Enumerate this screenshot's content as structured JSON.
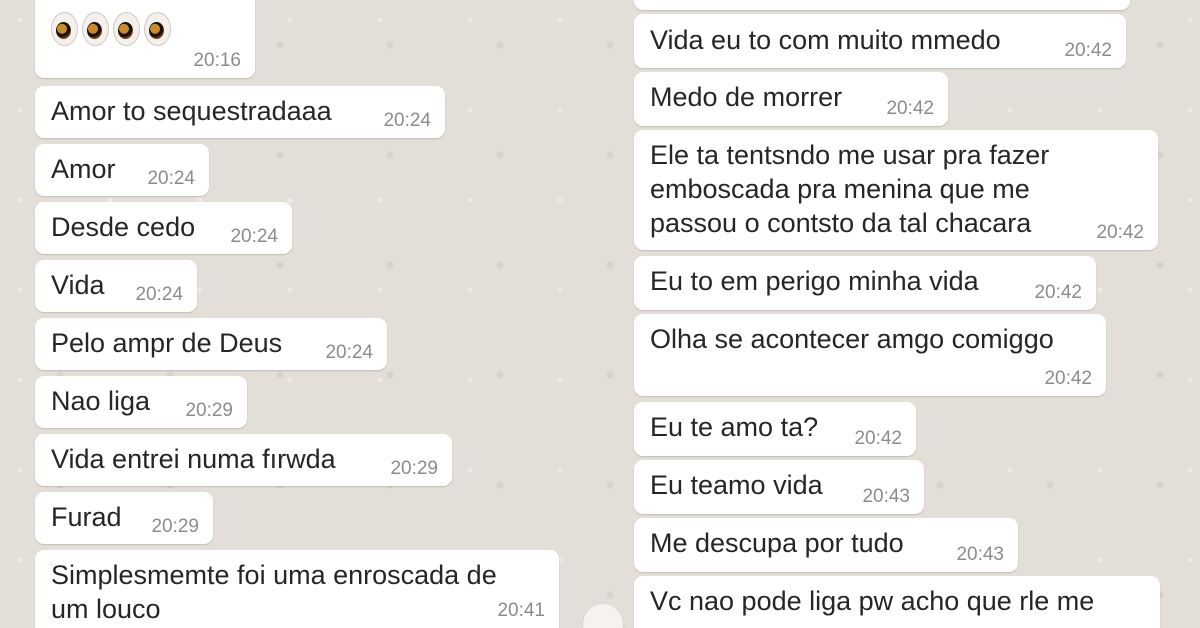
{
  "left_messages": [
    {
      "text": "",
      "time": "20:16",
      "emoji": "👀👀"
    },
    {
      "text": "Amor to sequestradaaa",
      "time": "20:24"
    },
    {
      "text": "Amor",
      "time": "20:24"
    },
    {
      "text": "Desde cedo",
      "time": "20:24"
    },
    {
      "text": "Vida",
      "time": "20:24"
    },
    {
      "text": "Pelo ampr de Deus",
      "time": "20:24"
    },
    {
      "text": "Nao liga",
      "time": "20:29"
    },
    {
      "text": "Vida entrei numa fırwda",
      "time": "20:29"
    },
    {
      "text": "Furad",
      "time": "20:29"
    },
    {
      "text": "Simplesmemte foi uma enroscada de\num louco",
      "time": "20:41"
    }
  ],
  "right_messages": [
    {
      "text": "",
      "time": ""
    },
    {
      "text": "Vida eu to com muito mmedo",
      "time": "20:42"
    },
    {
      "text": "Medo de morrer",
      "time": "20:42"
    },
    {
      "text": "Ele ta tentsndo me usar pra fazer\nemboscada pra menina que me\npassou o contsto da tal chacara",
      "time": "20:42"
    },
    {
      "text": "Eu to em perigo minha vida",
      "time": "20:42"
    },
    {
      "text": "Olha se acontecer amgo comiggo",
      "time": "20:42"
    },
    {
      "text": "Eu te amo ta?",
      "time": "20:42"
    },
    {
      "text": "Eu teamo vida",
      "time": "20:43"
    },
    {
      "text": "Me descupa por tudo",
      "time": "20:43"
    },
    {
      "text": "Vc nao pode liga pw acho que rle me",
      "time": ""
    }
  ]
}
